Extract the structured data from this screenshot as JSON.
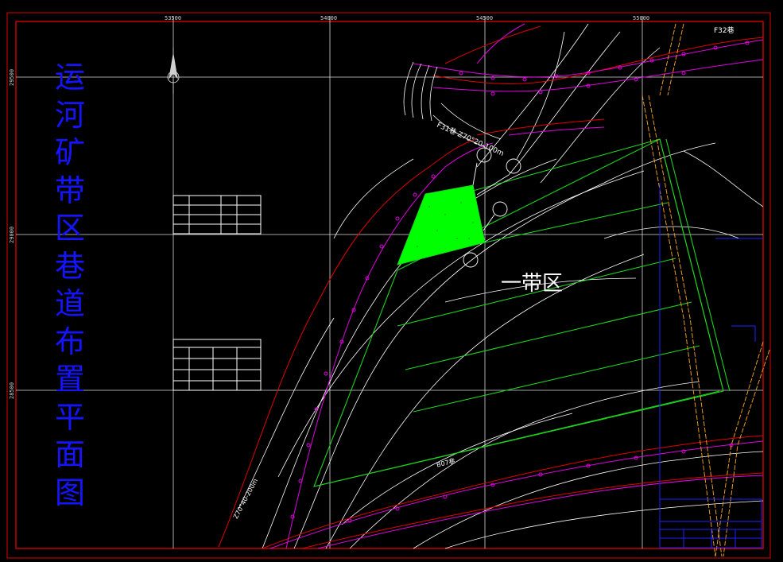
{
  "title_chars": [
    "运",
    "河",
    "矿",
    "带",
    "区",
    "巷",
    "道",
    "布",
    "置",
    "平",
    "面",
    "图"
  ],
  "top_coords": [
    "53500",
    "54000",
    "54500",
    "55000"
  ],
  "side_coords": [
    "29500",
    "29000",
    "28500"
  ],
  "zone_label": "一带区",
  "road_labels": {
    "f31": "F31巷 Z70°20-100m",
    "f32": "F32巷",
    "b07": "B07巷",
    "z70": "Z70°40-200m"
  },
  "colors": {
    "title": "#1414ff",
    "frame": "#e00000",
    "grid": "#d8d8d8",
    "contour": "#ffffff",
    "magenta": "#e000e0",
    "green": "#1fd01f",
    "fill": "#00ff00",
    "orange": "#e89a20"
  }
}
